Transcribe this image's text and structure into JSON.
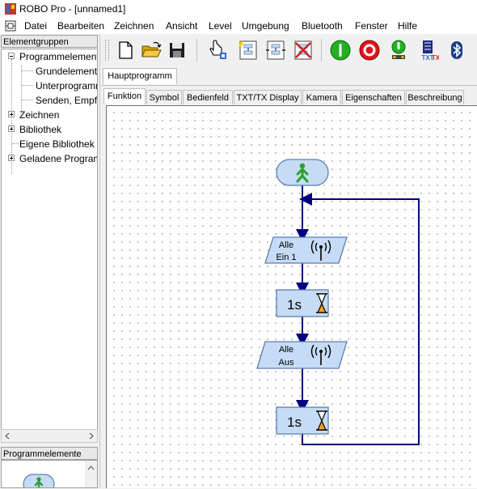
{
  "window": {
    "title": "ROBO Pro - [unnamed1]"
  },
  "menu": [
    "Datei",
    "Bearbeiten",
    "Zeichnen",
    "Ansicht",
    "Level",
    "Umgebung",
    "Bluetooth",
    "Fenster",
    "Hilfe"
  ],
  "left_panel": {
    "header": "Elementgruppen",
    "tree": [
      {
        "label": "Programmelemente"
      },
      {
        "label": "Grundelemente"
      },
      {
        "label": "Unterprogramme"
      },
      {
        "label": "Senden, Empfangen"
      },
      {
        "label": "Zeichnen"
      },
      {
        "label": "Bibliothek"
      },
      {
        "label": "Eigene Bibliothek"
      },
      {
        "label": "Geladene Programme"
      }
    ],
    "palette_header": "Programmelemente"
  },
  "toolbar": {
    "icons": [
      "new-file-icon",
      "open-folder-icon",
      "save-icon",
      "hand-pointer-icon",
      "new-subprogram-icon",
      "copy-subprogram-icon",
      "delete-subprogram-icon",
      "start-icon",
      "stop-icon",
      "download-icon",
      "txt-tx-icon",
      "bluetooth-icon"
    ],
    "txt_label": "TXT"
  },
  "program_tabs": [
    "Hauptprogramm"
  ],
  "sub_tabs": [
    "Funktion",
    "Symbol",
    "Bedienfeld",
    "TXT/TX Display",
    "Kamera",
    "Eigenschaften",
    "Beschreibung"
  ],
  "flowchart": {
    "colors": {
      "line": "#000080",
      "block_fill": "#c6dbf5",
      "block_border": "#5a7fae",
      "start_figure": "#2aa12a",
      "hourglass": "#f0a020"
    },
    "blocks": [
      {
        "type": "start"
      },
      {
        "type": "send",
        "line1": "Alle",
        "line2": "Ein 1"
      },
      {
        "type": "wait",
        "label": "1s"
      },
      {
        "type": "send",
        "line1": "Alle",
        "line2": "Aus"
      },
      {
        "type": "wait",
        "label": "1s"
      }
    ]
  }
}
